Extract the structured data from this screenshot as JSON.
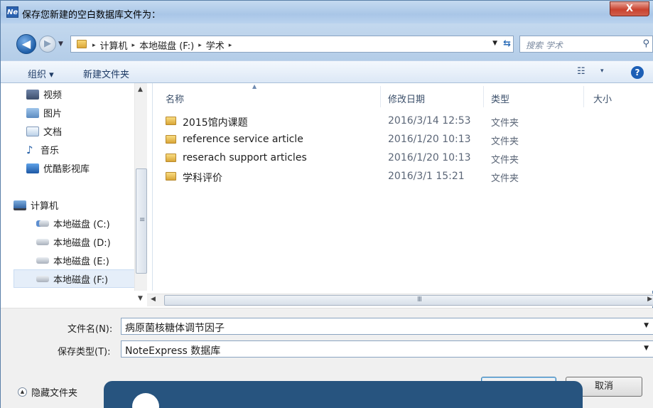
{
  "window": {
    "title": "保存您新建的空白数据库文件为：",
    "app_icon_text": "Ne",
    "close_glyph": "X"
  },
  "address": {
    "breadcrumbs": [
      "计算机",
      "本地磁盘 (F:)",
      "学术"
    ],
    "separator": "▸",
    "search_placeholder": "搜索 学术"
  },
  "toolbar": {
    "organize_label": "组织 ▾",
    "new_folder_label": "新建文件夹",
    "view_glyph": "☷",
    "view_drop": "▾",
    "help_glyph": "?"
  },
  "nav_pane": {
    "favorites": [
      {
        "label": "视频",
        "icon": "video-library-icon"
      },
      {
        "label": "图片",
        "icon": "pictures-library-icon"
      },
      {
        "label": "文档",
        "icon": "documents-library-icon"
      },
      {
        "label": "音乐",
        "icon": "music-library-icon"
      },
      {
        "label": "优酷影视库",
        "icon": "youku-library-icon"
      }
    ],
    "computer_label": "计算机",
    "drives": [
      {
        "label": "本地磁盘 (C:)"
      },
      {
        "label": "本地磁盘 (D:)"
      },
      {
        "label": "本地磁盘 (E:)"
      },
      {
        "label": "本地磁盘 (F:)",
        "selected": true
      }
    ]
  },
  "file_list": {
    "columns": [
      "名称",
      "修改日期",
      "类型",
      "大小"
    ],
    "rows": [
      {
        "name": "2015馆内课题",
        "date": "2016/3/14 12:53",
        "type": "文件夹"
      },
      {
        "name": "reference service article",
        "date": "2016/1/20 10:13",
        "type": "文件夹"
      },
      {
        "name": "reserach support articles",
        "date": "2016/1/20 10:13",
        "type": "文件夹"
      },
      {
        "name": "学科评价",
        "date": "2016/3/1 15:21",
        "type": "文件夹"
      }
    ]
  },
  "form": {
    "filename_label": "文件名(N):",
    "filename_value": "病原菌核糖体调节因子",
    "filetype_label": "保存类型(T):",
    "filetype_value": "NoteExpress 数据库",
    "hide_folders_label": "隐藏文件夹",
    "save_label": "",
    "cancel_label": "取消"
  },
  "colors": {
    "overlay": "#27547f",
    "accent": "#1d5fb6"
  }
}
